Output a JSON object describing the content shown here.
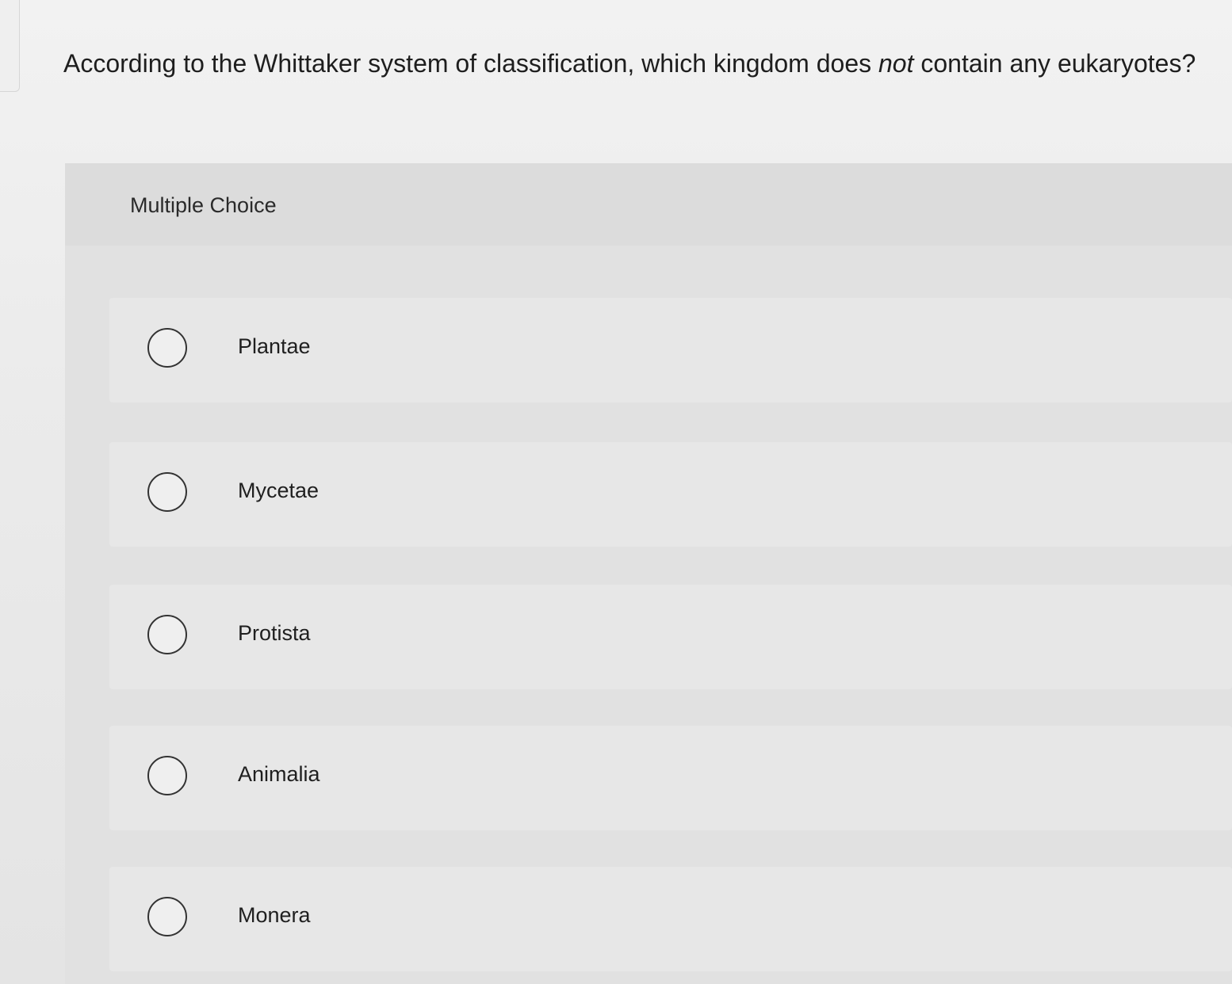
{
  "question": {
    "before": "According to the Whittaker system of classification, which kingdom does ",
    "emphasis": "not",
    "after": " contain any eukaryotes?"
  },
  "multiple_choice": {
    "label": "Multiple Choice",
    "options": [
      {
        "label": "Plantae"
      },
      {
        "label": "Mycetae"
      },
      {
        "label": "Protista"
      },
      {
        "label": "Animalia"
      },
      {
        "label": "Monera"
      }
    ]
  }
}
